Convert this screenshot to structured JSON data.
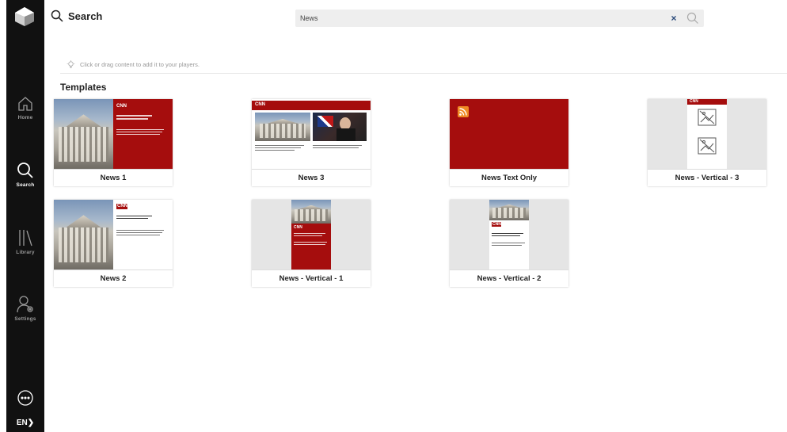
{
  "sidebar": {
    "items": [
      {
        "label": "Home",
        "icon": "home-icon"
      },
      {
        "label": "Search",
        "icon": "search-icon",
        "active": true
      },
      {
        "label": "Library",
        "icon": "library-icon"
      },
      {
        "label": "Settings",
        "icon": "settings-icon"
      }
    ],
    "language": "EN",
    "language_icon": "chevron-right-icon",
    "chat_icon": "chat-icon"
  },
  "header": {
    "title": "Search",
    "search_value": "News",
    "clear_label": "×"
  },
  "hint": {
    "text": "Click or drag content to add it to your players.",
    "icon": "lightbulb-icon"
  },
  "section": {
    "title": "Templates"
  },
  "templates": [
    {
      "label": "News 1"
    },
    {
      "label": "News 3"
    },
    {
      "label": "News Text Only"
    },
    {
      "label": "News - Vertical - 3"
    },
    {
      "label": "News 2"
    },
    {
      "label": "News - Vertical - 1"
    },
    {
      "label": "News - Vertical - 2"
    }
  ],
  "thumb_brand": "CNN",
  "colors": {
    "sidebar": "#111111",
    "accent_red": "#a50d0d",
    "rss_orange": "#f08a24",
    "clear_blue": "#2a4a7a"
  }
}
